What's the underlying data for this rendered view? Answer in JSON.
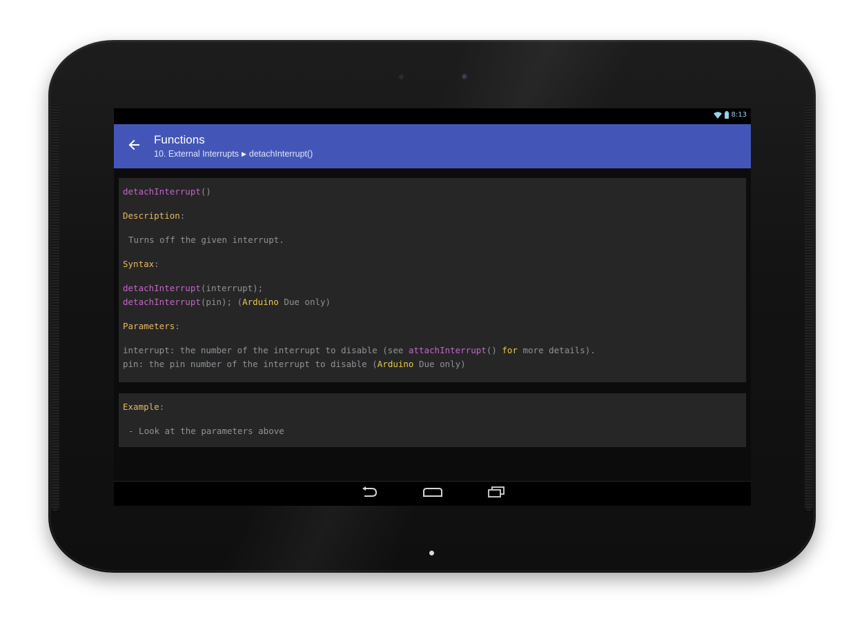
{
  "status_bar": {
    "time": "8:13"
  },
  "app_bar": {
    "title": "Functions",
    "breadcrumb": {
      "section": "10. External Interrupts",
      "separator": "▶",
      "item": "detachInterrupt()"
    },
    "color": "#4356b8"
  },
  "doc": {
    "signature": {
      "name": "detachInterrupt",
      "parens": "()"
    },
    "description": {
      "heading": "Description",
      "colon": ":",
      "text": "Turns off the given interrupt."
    },
    "syntax": {
      "heading": "Syntax",
      "colon": ":",
      "line1": {
        "fn": "detachInterrupt",
        "rest": "(interrupt);"
      },
      "line2": {
        "fn": "detachInterrupt",
        "rest_a": "(pin); (",
        "keyword": "Arduino",
        "rest_b": " Due only)"
      }
    },
    "parameters": {
      "heading": "Parameters",
      "colon": ":",
      "line1": {
        "text_a": "interrupt: the number of the interrupt to disable (see ",
        "fn": "attachInterrupt",
        "text_b": "() ",
        "keyword": "for",
        "text_c": " more details)."
      },
      "line2": {
        "text_a": "pin: the pin number of the interrupt to disable (",
        "keyword": "Arduino",
        "text_b": " Due only)"
      }
    },
    "example": {
      "heading": "Example",
      "colon": ":",
      "text": "- Look at the parameters above"
    }
  },
  "colors": {
    "function": "#c366c9",
    "heading": "#e8b862",
    "keyword": "#e8c84c",
    "text": "#8f9397",
    "card_bg": "#262626"
  },
  "icons": {
    "back": "arrow-left-icon",
    "wifi": "wifi-icon",
    "battery": "battery-icon",
    "nav_back": "back-nav-icon",
    "nav_home": "home-nav-icon",
    "nav_recents": "recents-nav-icon"
  }
}
